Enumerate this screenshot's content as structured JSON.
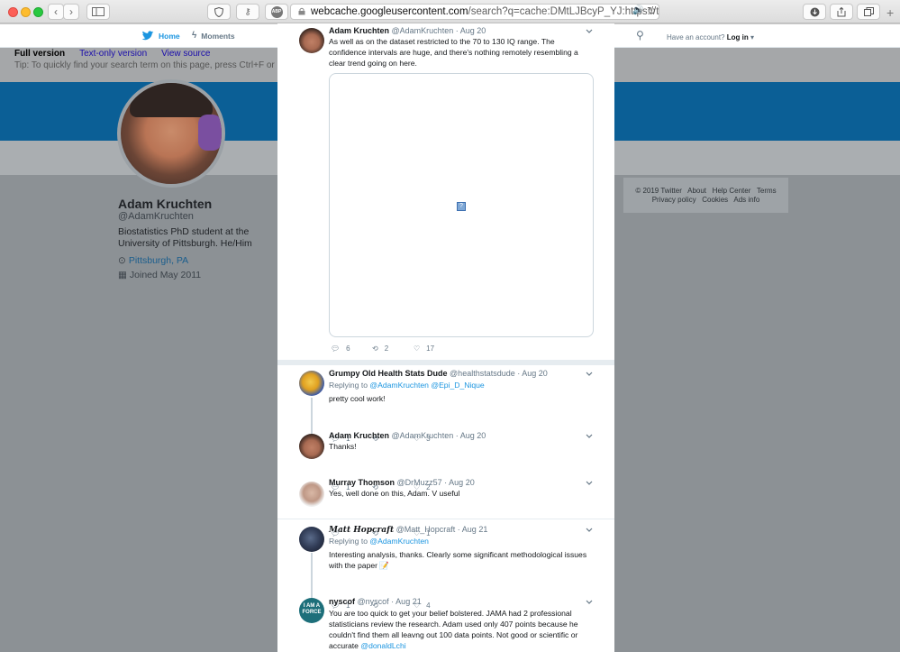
{
  "browser": {
    "url_host": "webcache.googleusercontent.com",
    "url_rest": "/search?q=cache:DMtLJBcyP_YJ:https://twitter.com/A",
    "ext_badge": "ABP"
  },
  "twitter_nav": {
    "home": "Home",
    "moments": "Moments",
    "have_account": "Have an account?",
    "login": "Log in"
  },
  "cache_bar": {
    "full_version": "Full version",
    "text_only": "Text-only version",
    "view_source": "View source",
    "tip": "Tip: To quickly find your search term on this page, press Ctrl+F or ⌘-F (Mac) and use the"
  },
  "profile": {
    "name": "Adam Kruchten",
    "handle": "@AdamKruchten",
    "bio": "Biostatistics PhD student at the University of Pittsburgh. He/Him",
    "location": "Pittsburgh, PA",
    "joined": "Joined May 2011"
  },
  "footer": {
    "line1": "© 2019 Twitter   About   Help Center   Terms",
    "line2": "Privacy policy   Cookies   Ads info"
  },
  "tweets": [
    {
      "name": "Adam Kruchten",
      "meta": "@AdamKruchten · Aug 20",
      "text": "As well as on the dataset restricted to the 70 to 130 IQ range. The confidence intervals are huge, and there's nothing remotely resembling a clear trend going on here.",
      "replies": "6",
      "retweets": "2",
      "likes": "17"
    },
    {
      "name": "Grumpy Old Health Stats Dude",
      "meta": "@healthstatsdude · Aug 20",
      "replying_label": "Replying to",
      "replying_to": "@AdamKruchten @Epi_D_Nique",
      "text": "pretty cool work!",
      "replies": "1",
      "retweets": "",
      "likes": "3"
    },
    {
      "name": "Adam Kruchten",
      "meta": "@AdamKruchten · Aug 20",
      "text": "Thanks!",
      "replies": "1",
      "retweets": "",
      "likes": "2"
    },
    {
      "name": "Murray Thomson",
      "meta": "@DrMuzz57 · Aug 20",
      "text": "Yes, well done on this, Adam. V useful",
      "replies": "",
      "retweets": "",
      "likes": "1"
    },
    {
      "name": "𝑴𝒂𝒕𝒕 𝑯𝒐𝒑𝒄𝒓𝒂𝒇𝒕",
      "meta": "@Matt_Hopcraft · Aug 21",
      "replying_label": "Replying to",
      "replying_to": "@AdamKruchten",
      "text": "Interesting analysis, thanks. Clearly some significant methodological issues with the paper 📝",
      "replies": "1",
      "retweets": "",
      "likes": "4"
    },
    {
      "name": "nyscof",
      "meta": "@nyscof · Aug 21",
      "avatar_text": "I AM A FORCE",
      "text": "You are too quick to get your belief bolstered. JAMA had 2 professional statisticians review the research. Adam used only 407 points because he couldn't find them all leavng out 100 data points.  Not good or scientific or accurate ",
      "mention": "@donaldLchi"
    }
  ],
  "colors": {
    "link": "#1b95e0",
    "banner": "#0b5f96",
    "muted": "#657786"
  }
}
